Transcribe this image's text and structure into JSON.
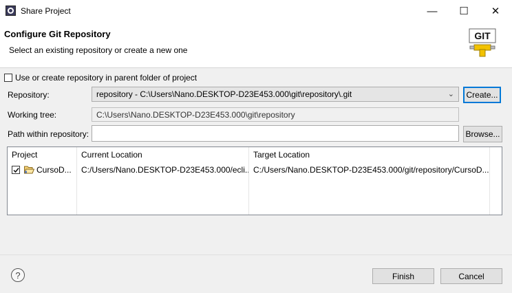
{
  "window": {
    "title": "Share Project",
    "minimize_glyph": "—",
    "maximize_glyph": "☐",
    "close_glyph": "✕"
  },
  "header": {
    "title": "Configure Git Repository",
    "subtitle": "Select an existing repository or create a new one",
    "logo_text": "GIT"
  },
  "options": {
    "parent_folder_label": "Use or create repository in parent folder of project",
    "parent_folder_checked": false
  },
  "form": {
    "repository_label": "Repository:",
    "repository_value": "repository - C:\\Users\\Nano.DESKTOP-D23E453.000\\git\\repository\\.git",
    "create_button": "Create...",
    "working_tree_label": "Working tree:",
    "working_tree_value": "C:\\Users\\Nano.DESKTOP-D23E453.000\\git\\repository",
    "path_label": "Path within repository:",
    "path_value": "",
    "browse_button": "Browse..."
  },
  "table": {
    "columns": [
      "Project",
      "Current Location",
      "Target Location"
    ],
    "rows": [
      {
        "checked": true,
        "project": "CursoD...",
        "current_location": "C:/Users/Nano.DESKTOP-D23E453.000/ecli...",
        "target_location": "C:/Users/Nano.DESKTOP-D23E453.000/git/repository/CursoD..."
      }
    ]
  },
  "footer": {
    "help_glyph": "?",
    "finish_button": "Finish",
    "cancel_button": "Cancel"
  },
  "colors": {
    "accent": "#0078d7",
    "background": "#f0f0f0",
    "git_logo_yellow": "#f2c200"
  }
}
